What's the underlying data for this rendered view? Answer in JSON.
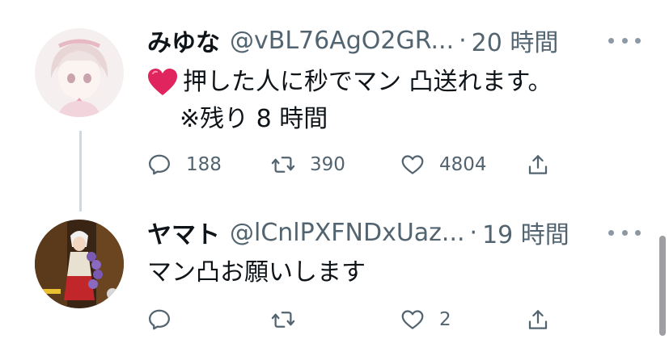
{
  "tweets": [
    {
      "display_name": "みゆな",
      "handle": "@vBL76AgO2GR...",
      "separator": "·",
      "time": "20 時間",
      "body_line_1": "押した人に秒でマン 凸送れます。",
      "body_line_2": "※残り 8 時間",
      "emoji": "red-heart",
      "replies": "188",
      "retweets": "390",
      "likes": "4804"
    },
    {
      "display_name": "ヤマト",
      "handle": "@lCnlPXFNDxUaz...",
      "separator": "·",
      "time": "19 時間",
      "body_line_1": "マン凸お願いします",
      "replies": "",
      "retweets": "",
      "likes": "2"
    }
  ],
  "colors": {
    "text_primary": "#0f1419",
    "text_secondary": "#536471",
    "thread_line": "#cfd9de",
    "heart": "#e0245e"
  }
}
